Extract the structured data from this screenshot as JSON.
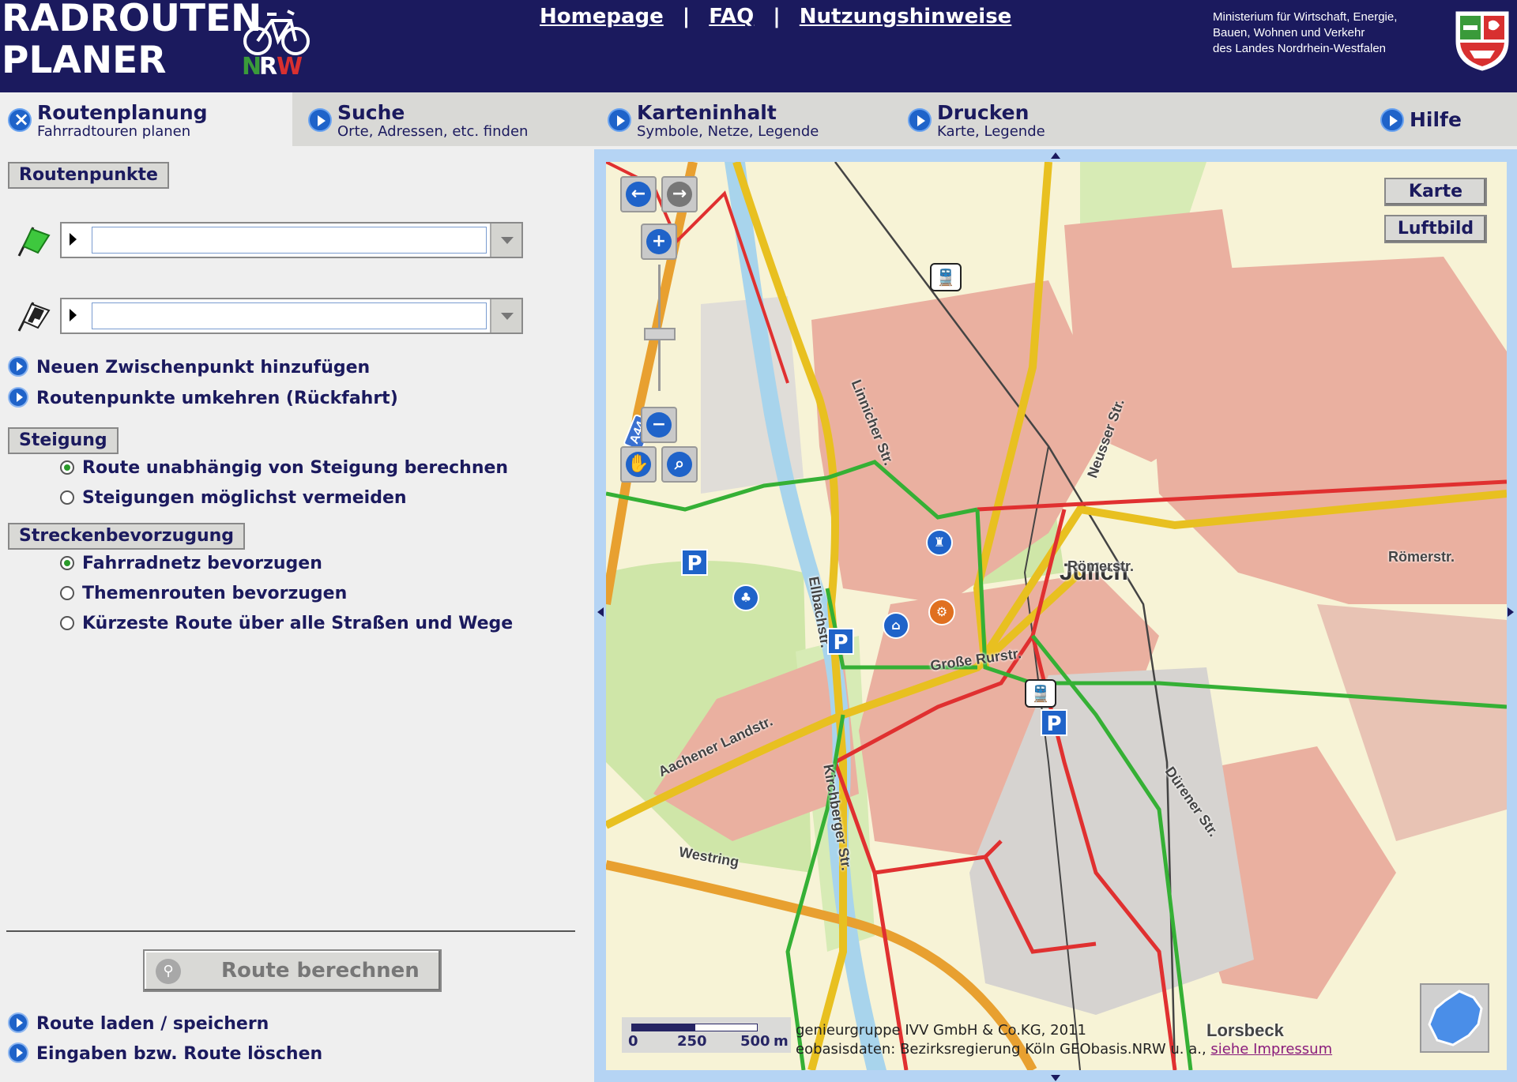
{
  "header": {
    "logo_line1": "RADROUTEN",
    "logo_line2": "PLANER",
    "logo_nrw": "NRW",
    "nav": [
      "Homepage",
      "FAQ",
      "Nutzungshinweise"
    ],
    "ministry_lines": [
      "Ministerium für Wirtschaft, Energie,",
      "Bauen, Wohnen und Verkehr",
      "des Landes Nordrhein-Westfalen"
    ]
  },
  "tabs": [
    {
      "title": "Routenplanung",
      "subtitle": "Fahrradtouren planen",
      "icon": "close-icon",
      "active": true
    },
    {
      "title": "Suche",
      "subtitle": "Orte, Adressen, etc. finden",
      "icon": "play-icon"
    },
    {
      "title": "Karteninhalt",
      "subtitle": "Symbole, Netze, Legende",
      "icon": "play-icon"
    },
    {
      "title": "Drucken",
      "subtitle": "Karte, Legende",
      "icon": "play-icon"
    },
    {
      "title": "Hilfe",
      "subtitle": "",
      "icon": "play-icon"
    }
  ],
  "routing": {
    "section_points": "Routenpunkte",
    "start_value": "",
    "end_value": "",
    "add_waypoint": "Neuen Zwischenpunkt hinzufügen",
    "reverse": "Routenpunkte umkehren (Rückfahrt)",
    "section_slope": "Steigung",
    "slope_options": [
      "Route unabhängig von Steigung berechnen",
      "Steigungen möglichst vermeiden"
    ],
    "slope_selected": 0,
    "section_pref": "Streckenbevorzugung",
    "pref_options": [
      "Fahrradnetz bevorzugen",
      "Themenrouten bevorzugen",
      "Kürzeste Route über alle Straßen und Wege"
    ],
    "pref_selected": 0,
    "calc_button": "Route berechnen",
    "load_save": "Route laden / speichern",
    "delete": "Eingaben bzw. Route löschen"
  },
  "map": {
    "layer_buttons": [
      "Karte",
      "Luftbild"
    ],
    "scale_labels": [
      "0",
      "250",
      "500",
      "m"
    ],
    "credit_line1": "genieurgruppe IVV GmbH & Co.KG, 2011",
    "credit_line2": "eobasisdaten: Bezirksregierung Köln GEObasis.NRW u. a.,",
    "credit_link": "siehe Impressum",
    "labels": {
      "city": "Jülich",
      "roemerstr1": "Römerstr.",
      "roemerstr2": "Römerstr.",
      "linnicher": "Linnicher Str.",
      "neusser": "Neusser Str.",
      "ellbachstr": "Ellbachstr.",
      "grosse_rurstr": "Große Rurstr.",
      "aachener": "Aachener Landstr.",
      "kirchberger": "Kirchberger Str.",
      "dueren": "Dürener Str.",
      "westring": "Westring",
      "a44": "A44",
      "lorsbeck": "Lorsbeck"
    },
    "colors": {
      "water": "#a8d4ec",
      "urban": "#eab0a0",
      "green": "#cfe6a8",
      "road_yellow": "#f5e050",
      "cycle_green": "#35b035",
      "cycle_red": "#e03030"
    }
  }
}
